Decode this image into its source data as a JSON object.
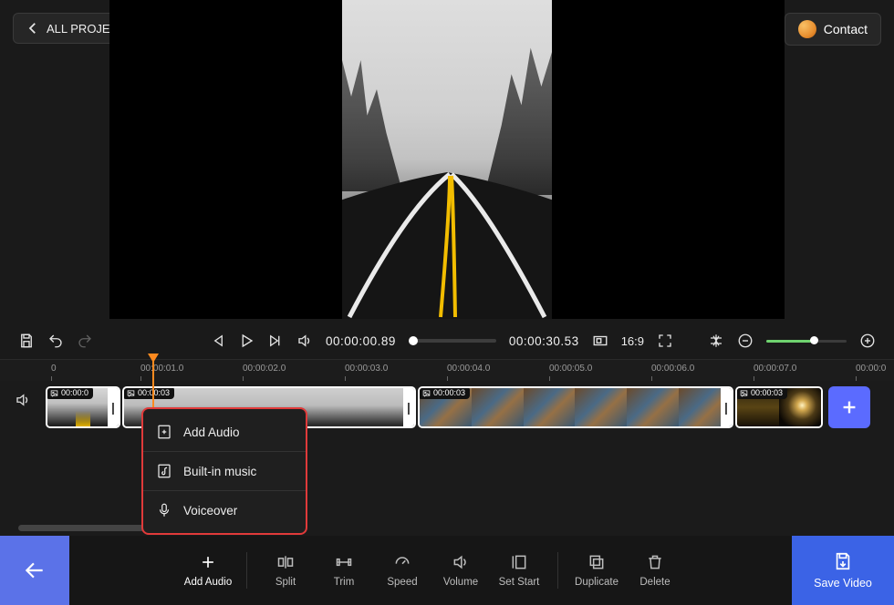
{
  "header": {
    "back_label": "ALL PROJECTS",
    "contact_label": "Contact"
  },
  "controls": {
    "current_time": "00:00:00.89",
    "total_time": "00:00:30.53",
    "aspect_ratio": "16:9"
  },
  "ruler": {
    "ticks": [
      "0",
      "00:00:01.0",
      "00:00:02.0",
      "00:00:03.0",
      "00:00:04.0",
      "00:00:05.0",
      "00:00:06.0",
      "00:00:07.0",
      "00:00:0"
    ]
  },
  "clips": [
    {
      "dur": "00:00:0"
    },
    {
      "dur": "00:00:03"
    },
    {
      "dur": "00:00:03"
    },
    {
      "dur": "00:00:03"
    }
  ],
  "popup": {
    "add_audio": "Add Audio",
    "builtin_music": "Built-in music",
    "voiceover": "Voiceover"
  },
  "toolbar": {
    "add_audio": "Add Audio",
    "split": "Split",
    "trim": "Trim",
    "speed": "Speed",
    "volume": "Volume",
    "set_start": "Set Start",
    "duplicate": "Duplicate",
    "delete": "Delete",
    "save_video": "Save Video"
  }
}
